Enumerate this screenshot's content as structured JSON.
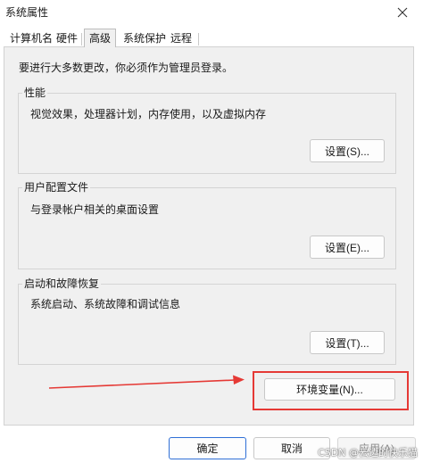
{
  "window": {
    "title": "系统属性",
    "close_icon": "close-icon"
  },
  "tabs": [
    {
      "label": "计算机名",
      "active": false
    },
    {
      "label": "硬件",
      "active": false
    },
    {
      "label": "高级",
      "active": true
    },
    {
      "label": "系统保护",
      "active": false
    },
    {
      "label": "远程",
      "active": false
    }
  ],
  "admin_note": "要进行大多数更改，你必须作为管理员登录。",
  "groups": {
    "performance": {
      "title": "性能",
      "desc": "视觉效果，处理器计划，内存使用，以及虚拟内存",
      "button": "设置(S)..."
    },
    "user_profiles": {
      "title": "用户配置文件",
      "desc": "与登录帐户相关的桌面设置",
      "button": "设置(E)..."
    },
    "startup_recovery": {
      "title": "启动和故障恢复",
      "desc": "系统启动、系统故障和调试信息",
      "button": "设置(T)..."
    }
  },
  "env_button": "环境变量(N)...",
  "footer": {
    "ok": "确定",
    "cancel": "取消",
    "apply": "应用(A)"
  },
  "watermark": "CSDN @云边的快乐猫",
  "colors": {
    "annotation_red": "#e53935",
    "panel_bg": "#f0f0f0",
    "default_button_border": "#2f6fd6"
  }
}
